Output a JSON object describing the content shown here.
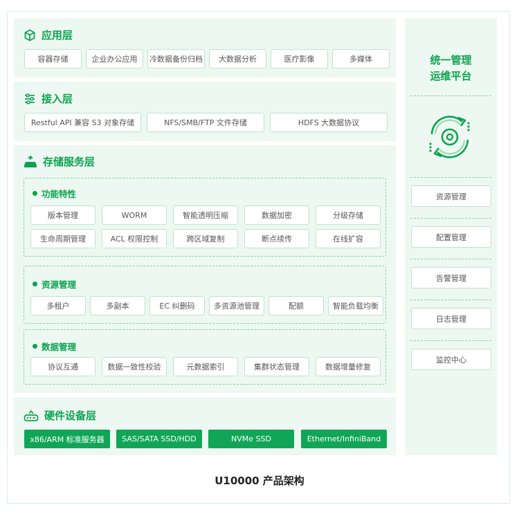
{
  "layers": {
    "app": {
      "title": "应用层",
      "items": [
        "容器存储",
        "企业办公应用",
        "冷数据备份归档",
        "大数据分析",
        "医疗影像",
        "多媒体"
      ]
    },
    "access": {
      "title": "接入层",
      "items": [
        "Restful API 兼容 S3 对象存储",
        "NFS/SMB/FTP 文件存储",
        "HDFS 大数据协议"
      ]
    },
    "storage": {
      "title": "存储服务层",
      "features": {
        "title": "功能特性",
        "row1": [
          "版本管理",
          "WORM",
          "智能透明压缩",
          "数据加密",
          "分级存储"
        ],
        "row2": [
          "生命周期管理",
          "ACL 权限控制",
          "跨区域复制",
          "断点续传",
          "在线扩容"
        ]
      },
      "resource": {
        "title": "资源管理",
        "items": [
          "多租户",
          "多副本",
          "EC 纠删码",
          "多资源池管理",
          "配额",
          "智能负载均衡"
        ]
      },
      "data": {
        "title": "数据管理",
        "items": [
          "协议互通",
          "数据一致性校验",
          "元数据索引",
          "集群状态管理",
          "数据增量修复"
        ]
      }
    },
    "hardware": {
      "title": "硬件设备层",
      "items": [
        "x86/ARM 标准服务器",
        "SAS/SATA SSD/HDD",
        "NVMe SSD",
        "Ethernet/InfiniBand"
      ]
    }
  },
  "platform": {
    "title_line1": "统一管理",
    "title_line2": "运维平台",
    "items": [
      "资源管理",
      "配置管理",
      "告警管理",
      "日志管理",
      "监控中心"
    ]
  },
  "caption": "U10000 产品架构",
  "colors": {
    "accent": "#0aa34f",
    "panel_bg": "#eef8f2",
    "hardware_bg": "#11a557"
  }
}
